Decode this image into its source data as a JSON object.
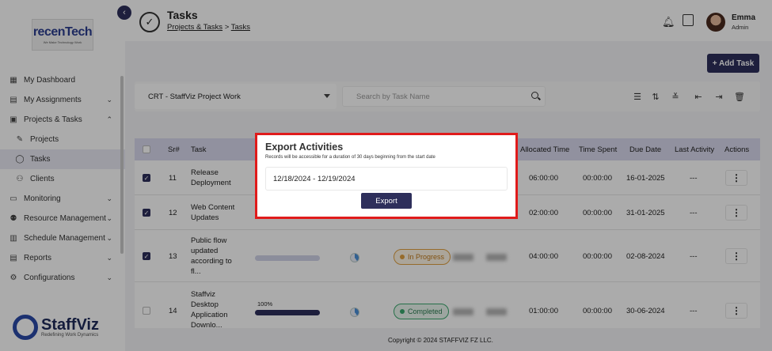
{
  "brand": {
    "logo_main_a": "recen",
    "logo_main_b": "Tech",
    "logo_sub": "We Make Technology Work",
    "footer_logo": "StaffViz",
    "footer_tagline": "Redefining Work Dynamics"
  },
  "sidebar": {
    "items": [
      {
        "label": "My Dashboard",
        "icon": "dashboard-icon"
      },
      {
        "label": "My Assignments",
        "icon": "clipboard-icon",
        "chevron": true
      },
      {
        "label": "Projects & Tasks",
        "icon": "calendar-icon",
        "chevron": true
      },
      {
        "label": "Projects",
        "icon": "edit-icon",
        "sub": true
      },
      {
        "label": "Tasks",
        "icon": "check-circle-icon",
        "sub": true,
        "active": true
      },
      {
        "label": "Clients",
        "icon": "people-icon",
        "sub": true
      },
      {
        "label": "Monitoring",
        "icon": "monitor-icon",
        "chevron": true
      },
      {
        "label": "Resource Management",
        "icon": "team-icon",
        "chevron": true
      },
      {
        "label": "Schedule Management",
        "icon": "schedule-icon",
        "chevron": true
      },
      {
        "label": "Reports",
        "icon": "report-icon",
        "chevron": true
      },
      {
        "label": "Configurations",
        "icon": "settings-icon",
        "chevron": true
      }
    ]
  },
  "header": {
    "title": "Tasks",
    "breadcrumb_link": "Projects & Tasks",
    "breadcrumb_sep": ">",
    "breadcrumb_current": "Tasks",
    "user_name": "Emma",
    "user_role": "Admin"
  },
  "toolbar": {
    "add_task": "+ Add Task",
    "project": "CRT - StaffViz Project Work",
    "search_placeholder": "Search by Task Name"
  },
  "table": {
    "columns": [
      "Sr#",
      "Task",
      "Allocated Time",
      "Time Spent",
      "Due Date",
      "Last Activity",
      "Actions"
    ],
    "rows": [
      {
        "sr": "11",
        "task_lines": [
          "Release",
          "Deployment"
        ],
        "allocated": "06:00:00",
        "spent": "00:00:00",
        "due": "16-01-2025",
        "last": "---",
        "checked": true
      },
      {
        "sr": "12",
        "task_lines": [
          "Web Content",
          "Updates"
        ],
        "allocated": "02:00:00",
        "spent": "00:00:00",
        "due": "31-01-2025",
        "last": "---",
        "checked": true
      },
      {
        "sr": "13",
        "task_lines": [
          "Public flow",
          "updated",
          "according to",
          "fl..."
        ],
        "allocated": "04:00:00",
        "spent": "00:00:00",
        "due": "02-08-2024",
        "last": "---",
        "checked": true,
        "status": "In Progress",
        "progress": 0.0
      },
      {
        "sr": "14",
        "task_lines": [
          "Staffviz",
          "Desktop",
          "Application",
          "Downlo..."
        ],
        "allocated": "01:00:00",
        "spent": "00:00:00",
        "due": "30-06-2024",
        "last": "---",
        "checked": false,
        "status": "Completed",
        "progress_label": "100%",
        "progress": 1.0
      }
    ],
    "actions_glyph": "⋮"
  },
  "footer": {
    "copyright": "Copyright © 2024 STAFFVIZ FZ LLC."
  },
  "modal": {
    "title": "Export Activities",
    "subtitle": "Records will be accessible for a duration of 30 days beginning from the start date",
    "date_range": "12/18/2024 - 12/19/2024",
    "export_label": "Export"
  },
  "colors": {
    "primary": "#2e2f5b",
    "highlight": "#e01b1b",
    "in_progress": "#e0a040",
    "completed": "#3aa76d"
  }
}
